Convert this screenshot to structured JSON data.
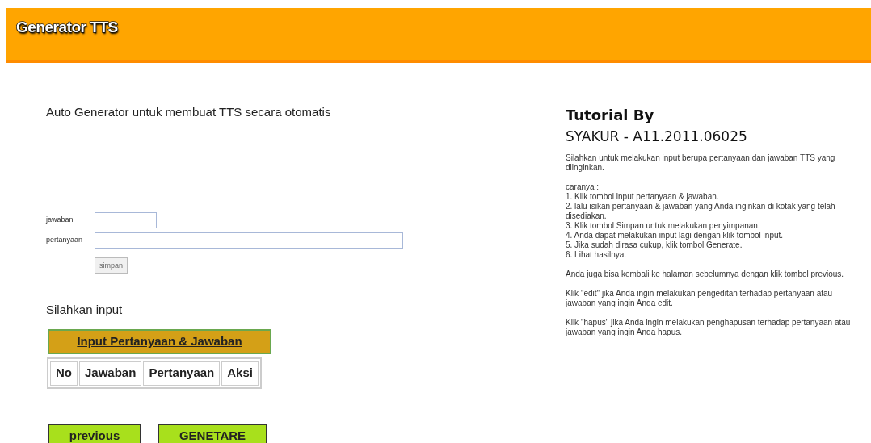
{
  "header": {
    "title": "Generator TTS"
  },
  "subtitle": "Auto Generator untuk membuat TTS secara otomatis",
  "form": {
    "fields": [
      {
        "label": "jawaban",
        "kind": "short"
      },
      {
        "label": "pertanyaan",
        "kind": "long"
      }
    ],
    "submit": "simpan"
  },
  "section_title": "Silahkan input",
  "input_button": "Input Pertanyaan & Jawaban",
  "table": {
    "columns": [
      "No",
      "Jawaban",
      "Pertanyaan",
      "Aksi"
    ]
  },
  "nav_buttons": [
    "previous",
    "GENETARE"
  ],
  "tutorial": {
    "title": "Tutorial By",
    "author": "SYAKUR - A11.2011.06025",
    "intro": "Silahkan untuk melakukan input berupa pertanyaan dan jawaban TTS yang diinginkan.",
    "steps_label": "caranya :",
    "steps": [
      "1. Klik tombol input pertanyaan & jawaban.",
      "2. lalu isikan pertanyaan & jawaban yang Anda inginkan di kotak yang telah disediakan.",
      "3. Klik tombol Simpan untuk melakukan penyimpanan.",
      "4. Anda dapat melakukan input lagi dengan klik tombol input.",
      "5. Jika sudah dirasa cukup, klik tombol Generate.",
      "6. Lihat hasilnya."
    ],
    "notes": [
      "Anda juga bisa kembali ke halaman sebelumnya dengan klik tombol previous.",
      "Klik \"edit\" jika Anda ingin melakukan pengeditan terhadap pertanyaan atau jawaban yang ingin Anda edit.",
      "Klik \"hapus\" jika Anda ingin melakukan penghapusan terhadap pertanyaan atau jawaban yang ingin Anda hapus."
    ]
  }
}
